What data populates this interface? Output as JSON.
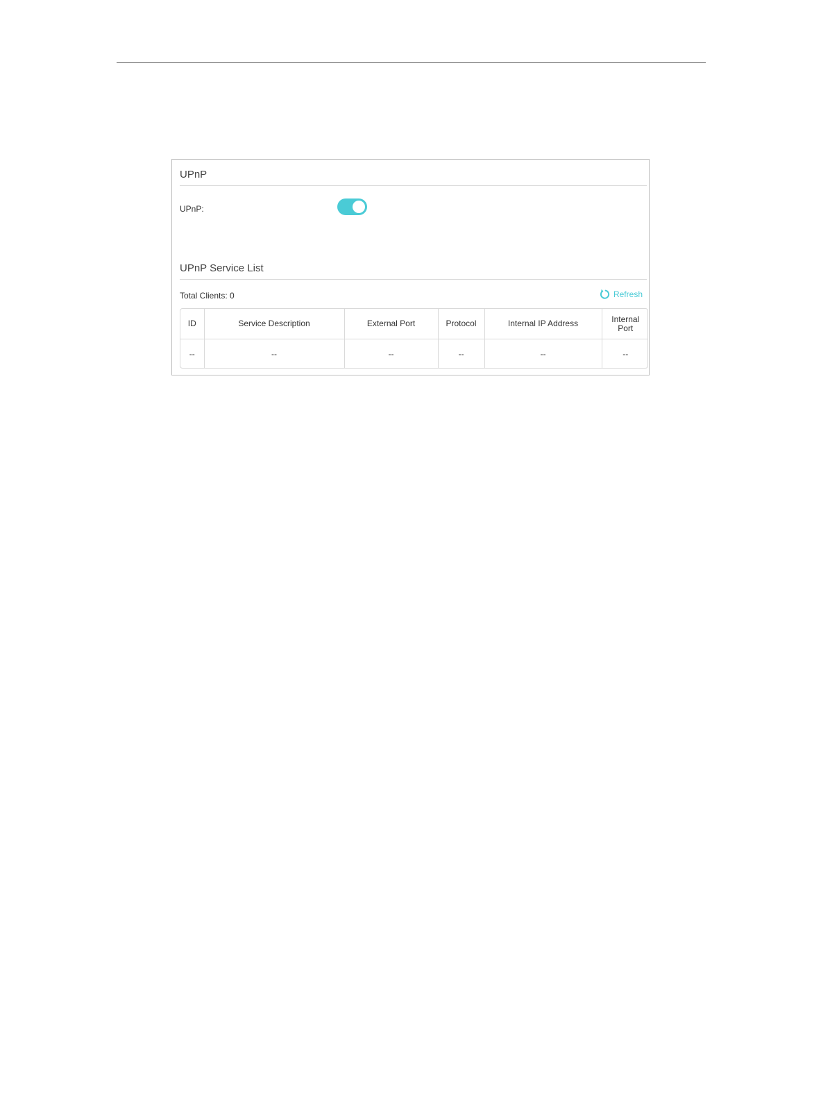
{
  "upnp_section": {
    "title": "UPnP",
    "upnp_label": "UPnP:",
    "upnp_enabled": true
  },
  "service_list": {
    "title": "UPnP Service List",
    "total_clients": "Total Clients: 0",
    "refresh_label": "Refresh",
    "columns": [
      "ID",
      "Service Description",
      "External Port",
      "Protocol",
      "Internal IP Address",
      "Internal Port"
    ],
    "rows": [
      [
        "--",
        "--",
        "--",
        "--",
        "--",
        "--"
      ]
    ]
  },
  "colors": {
    "accent": "#4acbd6",
    "border": "#d9d9d9",
    "panel_border": "#bfbfbf",
    "text": "#333333"
  },
  "icons": {
    "refresh": "refresh-icon"
  }
}
